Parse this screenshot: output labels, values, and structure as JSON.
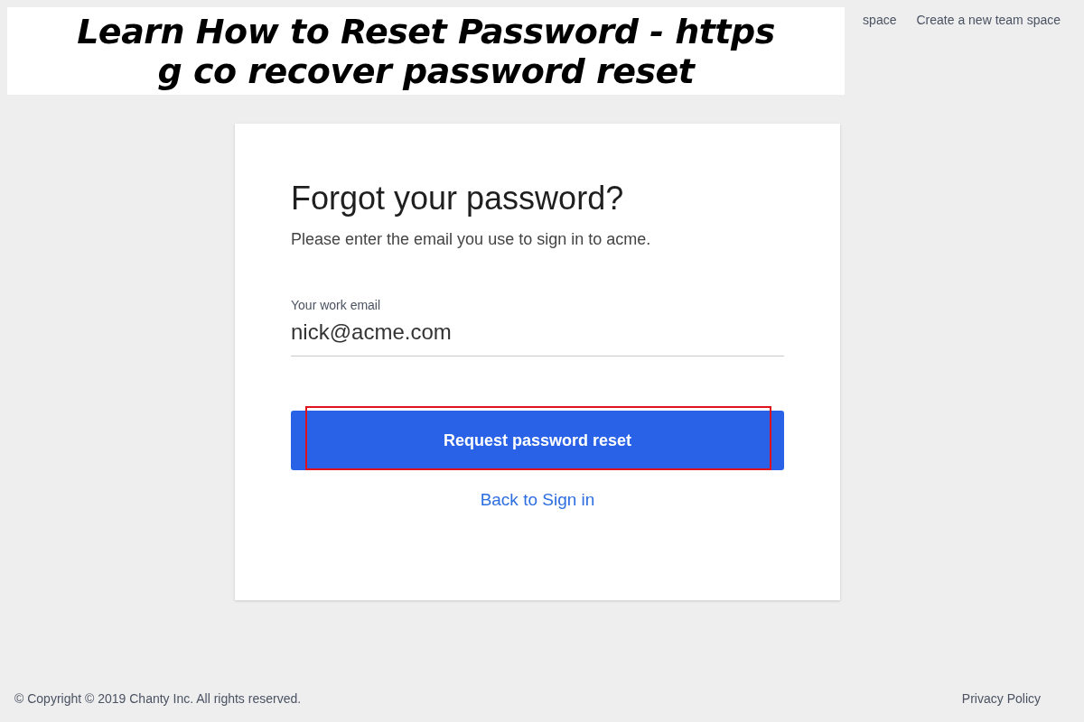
{
  "banner": {
    "lines": [
      "Learn How to Reset Password - https",
      "g co recover password reset"
    ]
  },
  "top_links": [
    "space",
    "Create a new team space"
  ],
  "card": {
    "title": "Forgot your password?",
    "subtitle": "Please enter the email you use to sign in to acme.",
    "email_field": {
      "label": "Your work email",
      "value": "nick@acme.com"
    },
    "submit_button": {
      "label": "Request password reset",
      "highlighted": true
    },
    "back_link": "Back to Sign in"
  },
  "footer": {
    "copyright": "© Copyright © 2019 Chanty Inc. All rights reserved.",
    "privacy_link": "Privacy Policy"
  }
}
